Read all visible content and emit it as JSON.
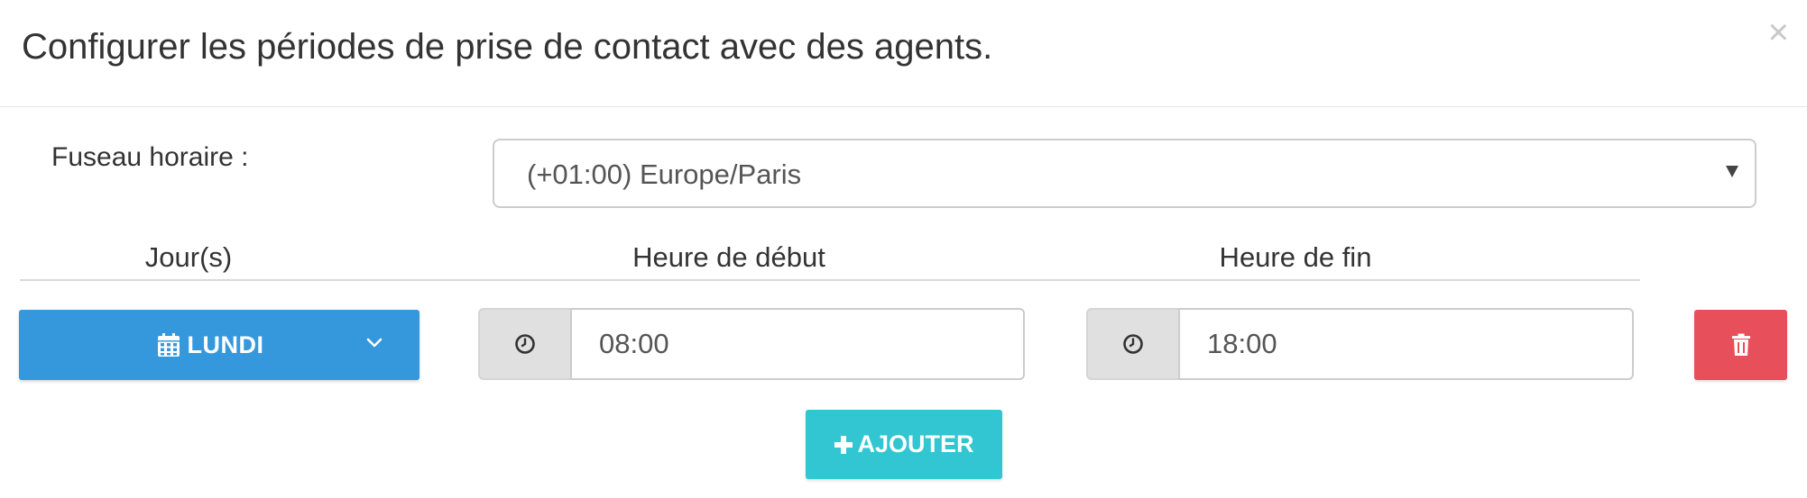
{
  "modal": {
    "title": "Configurer les périodes de prise de contact avec des agents.",
    "close_symbol": "×"
  },
  "timezone": {
    "label": "Fuseau horaire :",
    "selected": "(+01:00) Europe/Paris"
  },
  "columns": {
    "days": "Jour(s)",
    "start": "Heure de début",
    "end": "Heure de fin"
  },
  "period": {
    "day": "LUNDI",
    "start_time": "08:00",
    "end_time": "18:00"
  },
  "actions": {
    "add_label": "AJOUTER"
  },
  "icons": {
    "calendar": "calendar-icon",
    "chevron": "chevron-down-icon",
    "clock": "clock-icon",
    "trash": "trash-icon",
    "plus": "plus-icon",
    "close": "close-icon",
    "caret": "caret-down-icon"
  },
  "colors": {
    "day_button": "#3598dc",
    "delete_button": "#e7505a",
    "add_button": "#32c5d2",
    "addon_bg": "#e0e0e0"
  }
}
